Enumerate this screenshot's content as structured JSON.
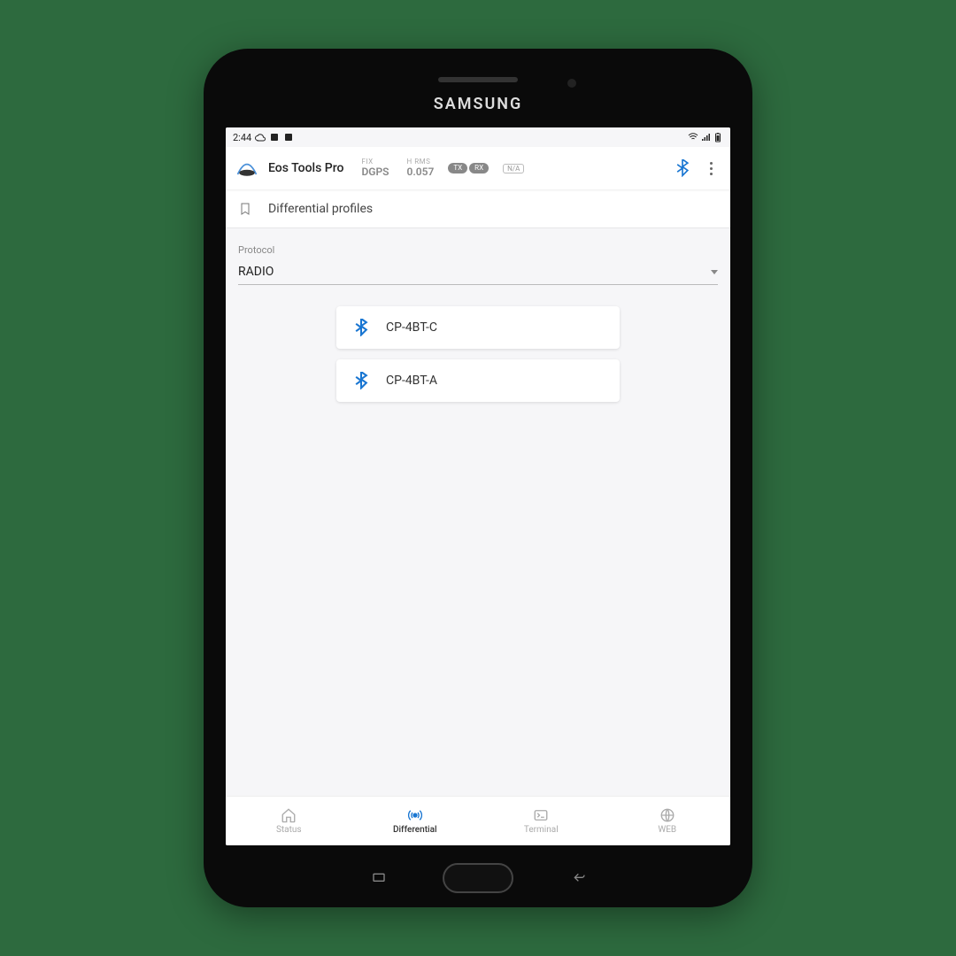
{
  "device": {
    "brand": "SAMSUNG"
  },
  "status_bar": {
    "time": "2:44"
  },
  "header": {
    "app_title": "Eos Tools Pro",
    "fix_label": "FIX",
    "fix_value": "DGPS",
    "hrms_label": "H RMS",
    "hrms_value": "0.057",
    "tx_label": "TX",
    "rx_label": "RX",
    "na_label": "N/A"
  },
  "section": {
    "title": "Differential profiles"
  },
  "protocol": {
    "label": "Protocol",
    "value": "RADIO"
  },
  "devices": [
    {
      "name": "CP-4BT-C"
    },
    {
      "name": "CP-4BT-A"
    }
  ],
  "nav": {
    "status": "Status",
    "differential": "Differential",
    "terminal": "Terminal",
    "web": "WEB"
  }
}
